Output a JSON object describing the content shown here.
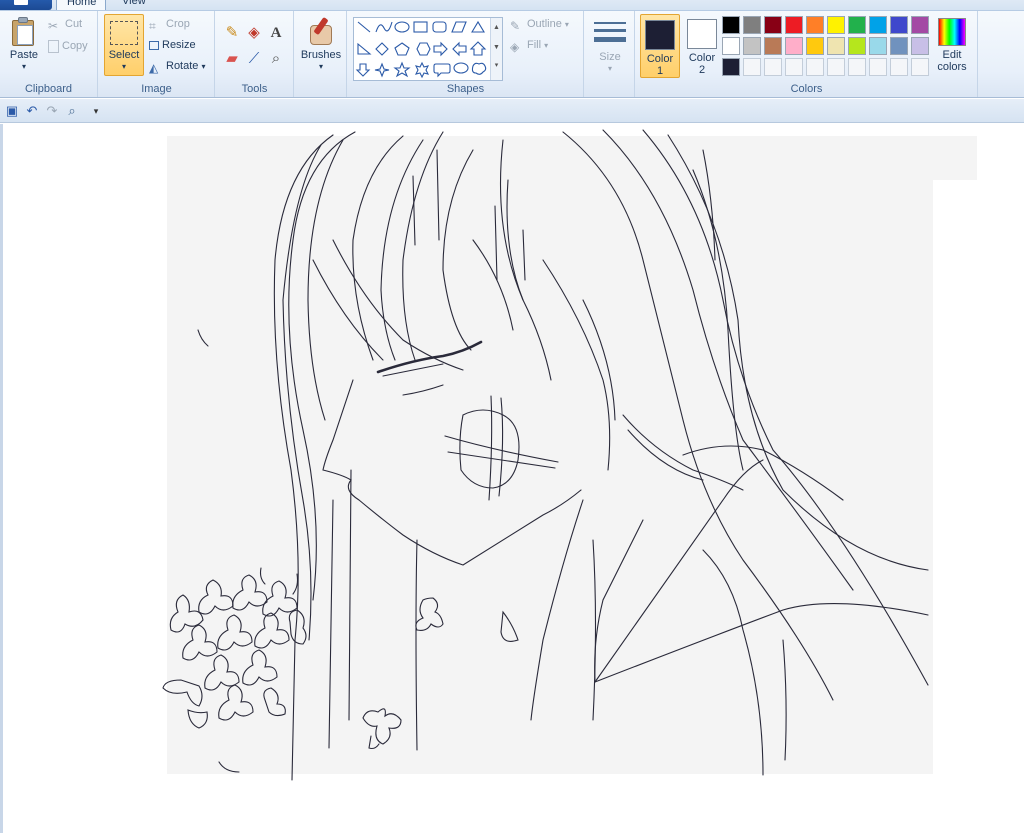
{
  "tabs": {
    "home": "Home",
    "view": "View"
  },
  "clipboard": {
    "label": "Clipboard",
    "paste": "Paste",
    "cut": "Cut",
    "copy": "Copy"
  },
  "image": {
    "label": "Image",
    "select": "Select",
    "crop": "Crop",
    "resize": "Resize",
    "rotate": "Rotate"
  },
  "tools": {
    "label": "Tools",
    "text_glyph": "A"
  },
  "brushes": {
    "label": "Brushes"
  },
  "shapes": {
    "label": "Shapes",
    "outline": "Outline",
    "fill": "Fill"
  },
  "size": {
    "label": "Size"
  },
  "colors": {
    "label": "Colors",
    "color1": "Color",
    "color1_num": "1",
    "color2": "Color",
    "color2_num": "2",
    "edit": "Edit",
    "edit2": "colors",
    "color1_value": "#1d1f34",
    "color2_value": "#ffffff",
    "palette_row1": [
      "#000000",
      "#7f7f7f",
      "#880015",
      "#ed1c24",
      "#ff7f27",
      "#fff200",
      "#22b14c",
      "#00a2e8",
      "#3f48cc",
      "#a349a4"
    ],
    "palette_row2": [
      "#ffffff",
      "#c3c3c3",
      "#b97a57",
      "#ffaec9",
      "#ffc90e",
      "#efe4b0",
      "#b5e61d",
      "#99d9ea",
      "#7092be",
      "#c8bfe7"
    ],
    "palette_row3": [
      "#1d1f34"
    ]
  },
  "icons": {
    "save": "save-icon",
    "undo": "undo-icon",
    "redo": "redo-icon",
    "zoom": "magnifier-icon",
    "customize": "dropdown-icon"
  }
}
